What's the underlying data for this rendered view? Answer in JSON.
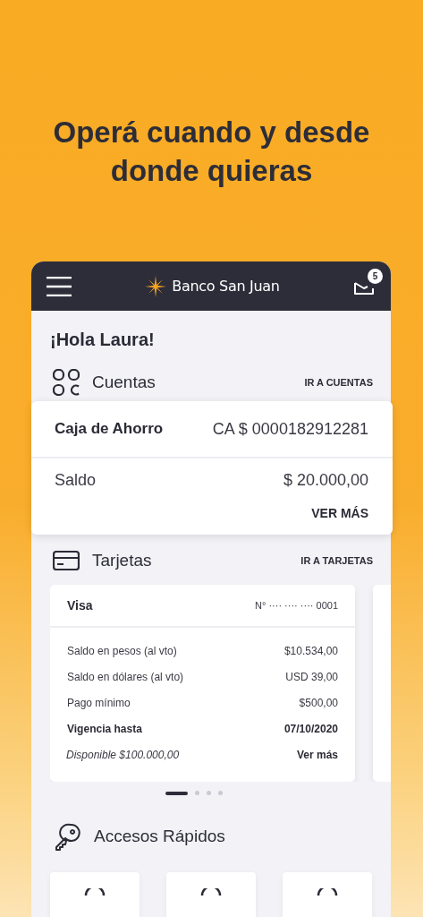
{
  "headline": "Operá cuando y desde donde quieras",
  "app_header": {
    "brand": "Banco San Juan",
    "badge": "5"
  },
  "greeting": "¡Hola Laura!",
  "accounts_section": {
    "title": "Cuentas",
    "link": "IR A CUENTAS"
  },
  "account_card": {
    "name": "Caja de Ahorro",
    "number": "CA $ 0000182912281",
    "balance_label": "Saldo",
    "balance": "$ 20.000,00",
    "more": "VER MÁS"
  },
  "cards_section": {
    "title": "Tarjetas",
    "link": "IR A TARJETAS"
  },
  "credit_card": {
    "brand": "Visa",
    "number": "N° ···· ···· ···· 0001",
    "rows": [
      {
        "label": "Saldo en pesos (al vto)",
        "value": "$10.534,00",
        "kind": "normal"
      },
      {
        "label": "Saldo en dólares (al vto)",
        "value": "USD 39,00",
        "kind": "normal"
      },
      {
        "label": "Pago mínimo",
        "value": "$500,00",
        "kind": "normal"
      },
      {
        "label": "Vigencia hasta",
        "value": "07/10/2020",
        "kind": "bold"
      }
    ],
    "available": "Disponible $100.000,00",
    "more": "Ver más"
  },
  "carousel_dots": [
    {
      "selected": true
    },
    {
      "selected": false
    },
    {
      "selected": false
    },
    {
      "selected": false
    }
  ],
  "quick_access": {
    "title": "Accesos Rápidos",
    "tiles": [
      {
        "kind": "tile"
      },
      {
        "kind": "tile"
      },
      {
        "kind": "tile"
      }
    ]
  }
}
